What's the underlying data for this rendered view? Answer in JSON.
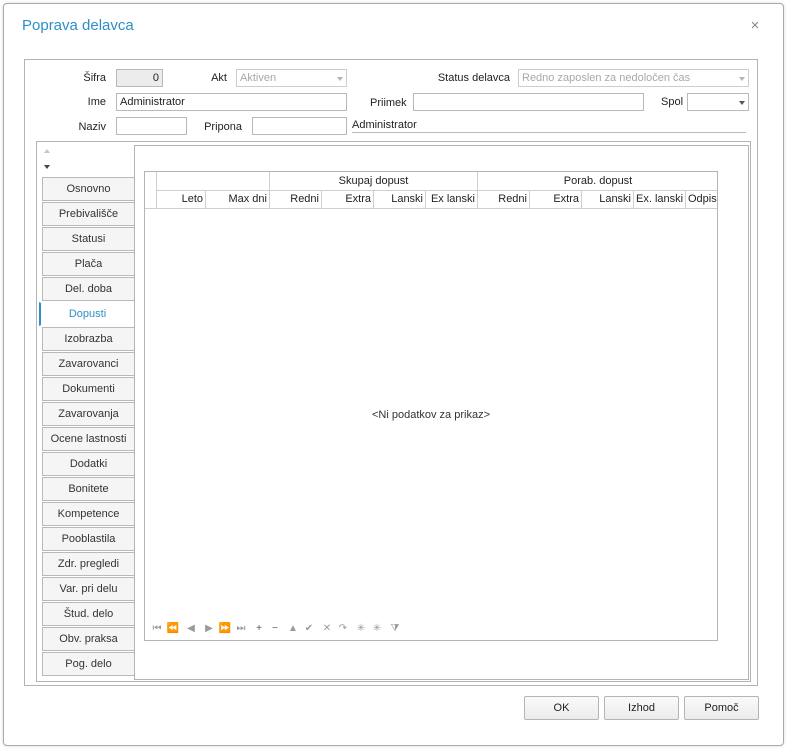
{
  "dialog": {
    "title": "Poprava delavca",
    "close": "×"
  },
  "form": {
    "sifra_label": "Šifra",
    "sifra_value": "0",
    "akt_label": "Akt",
    "akt_value": "Aktiven",
    "status_label": "Status delavca",
    "status_value": "Redno zaposlen za nedoločen čas",
    "ime_label": "Ime",
    "ime_value": "Administrator",
    "priimek_label": "Priimek",
    "priimek_value": "",
    "spol_label": "Spol",
    "spol_value": "",
    "naziv_label": "Naziv",
    "naziv_value": "",
    "pripona_label": "Pripona",
    "pripona_value": "",
    "display_name": "Administrator"
  },
  "tabs": [
    {
      "label": "Osnovno"
    },
    {
      "label": "Prebivališče"
    },
    {
      "label": "Statusi"
    },
    {
      "label": "Plača"
    },
    {
      "label": "Del. doba"
    },
    {
      "label": "Dopusti",
      "active": true
    },
    {
      "label": "Izobrazba"
    },
    {
      "label": "Zavarovanci"
    },
    {
      "label": "Dokumenti"
    },
    {
      "label": "Zavarovanja"
    },
    {
      "label": "Ocene lastnosti"
    },
    {
      "label": "Dodatki"
    },
    {
      "label": "Bonitete"
    },
    {
      "label": "Kompetence"
    },
    {
      "label": "Pooblastila"
    },
    {
      "label": "Zdr. pregledi"
    },
    {
      "label": "Var. pri delu"
    },
    {
      "label": "Štud. delo"
    },
    {
      "label": "Obv. praksa"
    },
    {
      "label": "Pog. delo"
    }
  ],
  "grid": {
    "bands": [
      "Skupaj dopust",
      "Porab. dopust"
    ],
    "columns": [
      "Leto",
      "Max dni",
      "Redni",
      "Extra",
      "Lanski",
      "Ex lanski",
      "Redni",
      "Extra",
      "Lanski",
      "Ex. lanski",
      "Odpisa"
    ],
    "empty_text": "<Ni podatkov za prikaz>"
  },
  "navigator": [
    {
      "icon": "first-icon",
      "glyph": "⏮"
    },
    {
      "icon": "prev-page-icon",
      "glyph": "⏪"
    },
    {
      "icon": "prev-icon",
      "glyph": "◀"
    },
    {
      "icon": "next-icon",
      "glyph": "▶"
    },
    {
      "icon": "next-page-icon",
      "glyph": "⏩"
    },
    {
      "icon": "last-icon",
      "glyph": "⏭"
    },
    {
      "icon": "insert-icon",
      "glyph": "+"
    },
    {
      "icon": "delete-icon",
      "glyph": "−"
    },
    {
      "icon": "edit-icon",
      "glyph": "▲"
    },
    {
      "icon": "post-icon",
      "glyph": "✔"
    },
    {
      "icon": "cancel-icon",
      "glyph": "✕"
    },
    {
      "icon": "refresh-icon",
      "glyph": "↷"
    },
    {
      "icon": "bookmark-icon",
      "glyph": "✳"
    },
    {
      "icon": "goto-bookmark-icon",
      "glyph": "✳"
    },
    {
      "icon": "filter-icon",
      "glyph": "⧩"
    }
  ],
  "buttons": {
    "ok": "OK",
    "exit": "Izhod",
    "help": "Pomoč"
  }
}
